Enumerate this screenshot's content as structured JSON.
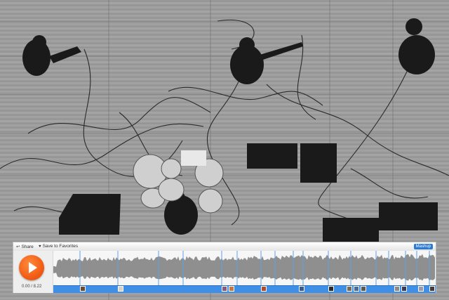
{
  "player": {
    "share_label": "Share",
    "favorites_label": "Save to Favorites",
    "mashup_label": "Mashup",
    "time": "0.00 / 8.22",
    "icons": {
      "share": "share-icon",
      "favorite": "heart-icon",
      "play": "play-icon"
    },
    "colors": {
      "accent": "#f15a13",
      "track": "#3f8fe6",
      "badge": "#2b7ad4"
    },
    "progress": 0
  },
  "comments": [
    {
      "color": "#6b4a3a"
    },
    {
      "color": "#d8d0c4"
    },
    {
      "color": "#8a5a7a"
    },
    {
      "color": "#c47a3a"
    },
    {
      "color": "#b04a2a"
    },
    {
      "color": "#3a5a8a"
    },
    {
      "color": "#2a2a2a"
    },
    {
      "color": "#7a6a5a"
    },
    {
      "color": "#4a6a9a"
    },
    {
      "color": "#5a5a5a"
    },
    {
      "color": "#8a8a8a"
    },
    {
      "color": "#3a3a5a"
    },
    {
      "color": "#9a9aaa"
    },
    {
      "color": "#4a3a3a"
    }
  ]
}
